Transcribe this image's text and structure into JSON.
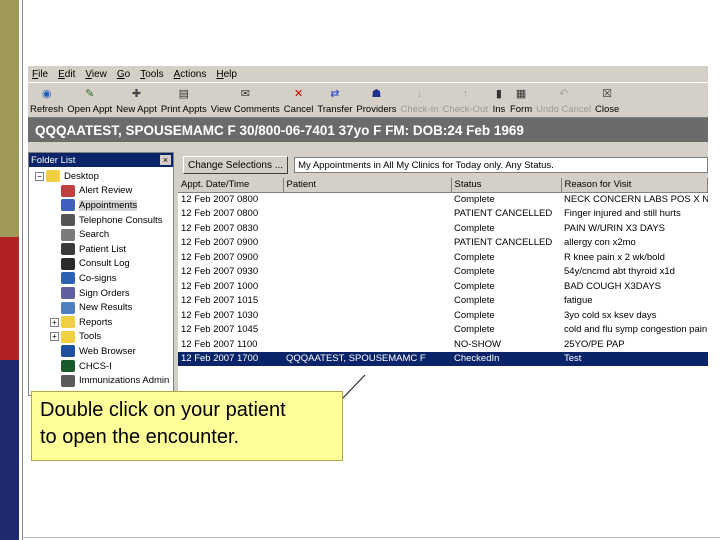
{
  "menu": [
    "File",
    "Edit",
    "View",
    "Go",
    "Tools",
    "Actions",
    "Help"
  ],
  "toolbar": [
    {
      "label": "Refresh",
      "icon": "refresh-icon",
      "glyph": "◉",
      "color": "#1f5fbf",
      "enabled": true
    },
    {
      "label": "Open Appt",
      "icon": "open-appt-icon",
      "glyph": "✎",
      "color": "#2a6a2a",
      "enabled": true
    },
    {
      "label": "New Appt",
      "icon": "new-appt-icon",
      "glyph": "✚",
      "color": "#444444",
      "enabled": true
    },
    {
      "label": "Print Appts",
      "icon": "printer-icon",
      "glyph": "▤",
      "color": "#333333",
      "enabled": true
    },
    {
      "label": "View Comments",
      "icon": "comments-icon",
      "glyph": "✉",
      "color": "#333333",
      "enabled": true
    },
    {
      "label": "Cancel",
      "icon": "cancel-icon",
      "glyph": "✕",
      "color": "#cc0000",
      "enabled": true
    },
    {
      "label": "Transfer",
      "icon": "transfer-icon",
      "glyph": "⇄",
      "color": "#1f3fbf",
      "enabled": true
    },
    {
      "label": "Providers",
      "icon": "providers-icon",
      "glyph": "☗",
      "color": "#1f2f8f",
      "enabled": true
    },
    {
      "label": "Check-In",
      "icon": "check-in-icon",
      "glyph": "↓",
      "color": "#a0a0a0",
      "enabled": false
    },
    {
      "label": "Check-Out",
      "icon": "check-out-icon",
      "glyph": "↑",
      "color": "#a0a0a0",
      "enabled": false
    },
    {
      "label": "Ins",
      "icon": "insurance-icon",
      "glyph": "▮",
      "color": "#333333",
      "enabled": true
    },
    {
      "label": "Form",
      "icon": "form-icon",
      "glyph": "▦",
      "color": "#333333",
      "enabled": true
    },
    {
      "label": "Undo Cancel",
      "icon": "undo-icon",
      "glyph": "↶",
      "color": "#a0a0a0",
      "enabled": false
    },
    {
      "label": "Close",
      "icon": "close-icon",
      "glyph": "☒",
      "color": "#333333",
      "enabled": true
    }
  ],
  "banner": "QQQAATEST, SPOUSEMAMC F  30/800-06-7401  37yo  F   FM:  DOB:24 Feb 1969",
  "folder_list": {
    "title": "Folder List",
    "close": "×",
    "items": [
      {
        "label": "Desktop",
        "icon": "desktop-folder-icon",
        "color": "#f0d040",
        "expander": "−",
        "indent": 0
      },
      {
        "label": "Alert Review",
        "icon": "alert-review-icon",
        "color": "#c04040",
        "indent": 1
      },
      {
        "label": "Appointments",
        "icon": "appointments-icon",
        "color": "#4060c0",
        "indent": 1,
        "selected": true
      },
      {
        "label": "Telephone Consults",
        "icon": "telephone-icon",
        "color": "#555555",
        "indent": 1
      },
      {
        "label": "Search",
        "icon": "search-icon",
        "color": "#7a7a7a",
        "indent": 1
      },
      {
        "label": "Patient List",
        "icon": "patient-list-icon",
        "color": "#3a3a3a",
        "indent": 1
      },
      {
        "label": "Consult Log",
        "icon": "consult-log-icon",
        "color": "#2a2a2a",
        "indent": 1
      },
      {
        "label": "Co-signs",
        "icon": "co-signs-icon",
        "color": "#3060b0",
        "indent": 1
      },
      {
        "label": "Sign Orders",
        "icon": "sign-orders-icon",
        "color": "#6060a0",
        "indent": 1
      },
      {
        "label": "New Results",
        "icon": "new-results-icon",
        "color": "#5080c0",
        "indent": 1
      },
      {
        "label": "Reports",
        "icon": "reports-folder-icon",
        "color": "#f0d040",
        "expander": "+",
        "indent": 1
      },
      {
        "label": "Tools",
        "icon": "tools-folder-icon",
        "color": "#f0d040",
        "expander": "+",
        "indent": 1
      },
      {
        "label": "Web Browser",
        "icon": "globe-icon",
        "color": "#2050a0",
        "indent": 1
      },
      {
        "label": "CHCS-I",
        "icon": "chcs-icon",
        "color": "#1a5a2a",
        "indent": 1
      },
      {
        "label": "Immunizations Admin",
        "icon": "immunizations-icon",
        "color": "#5a5a5a",
        "indent": 1
      }
    ]
  },
  "filter": {
    "button": "Change Selections ...",
    "text": "My Appointments in All My Clinics for Today only. Any Status."
  },
  "table": {
    "columns": [
      "Appt. Date/Time",
      "Patient",
      "Status",
      "Reason for Visit"
    ],
    "rows": [
      {
        "date": "12 Feb 2007 0800",
        "patient": "",
        "status": "Complete",
        "reason": "NECK CONCERN LABS POS X N"
      },
      {
        "date": "12 Feb 2007 0800",
        "patient": "",
        "status": "PATIENT CANCELLED",
        "reason": "Finger injured and still hurts"
      },
      {
        "date": "12 Feb 2007 0830",
        "patient": "",
        "status": "Complete",
        "reason": "PAIN W/URIN X3 DAYS"
      },
      {
        "date": "12 Feb 2007 0900",
        "patient": "",
        "status": "PATIENT CANCELLED",
        "reason": "allergy con x2mo"
      },
      {
        "date": "12 Feb 2007 0900",
        "patient": "",
        "status": "Complete",
        "reason": "R knee pain x 2 wk/bold"
      },
      {
        "date": "12 Feb 2007 0930",
        "patient": "",
        "status": "Complete",
        "reason": "54y/cncmd abt thyroid x1d"
      },
      {
        "date": "12 Feb 2007 1000",
        "patient": "",
        "status": "Complete",
        "reason": "BAD COUGH X3DAYS"
      },
      {
        "date": "12 Feb 2007 1015",
        "patient": "",
        "status": "Complete",
        "reason": "fatigue"
      },
      {
        "date": "12 Feb 2007 1030",
        "patient": "",
        "status": "Complete",
        "reason": "3yo cold sx ksev days"
      },
      {
        "date": "12 Feb 2007 1045",
        "patient": "",
        "status": "Complete",
        "reason": "cold and flu symp congestion pain"
      },
      {
        "date": "12 Feb 2007 1100",
        "patient": "",
        "status": "NO-SHOW",
        "reason": "25YO/PE PAP"
      },
      {
        "date": "12 Feb 2007 1700",
        "patient": "QQQAATEST, SPOUSEMAMC F",
        "status": "CheckedIn",
        "reason": "Test",
        "selected": true
      }
    ]
  },
  "callout": {
    "line1": "Double click on your patient",
    "line2": "to open the encounter."
  },
  "colors": {
    "selection": "#0a246a",
    "banner_bg": "#6b6b6b",
    "callout_bg": "#ffff99"
  }
}
